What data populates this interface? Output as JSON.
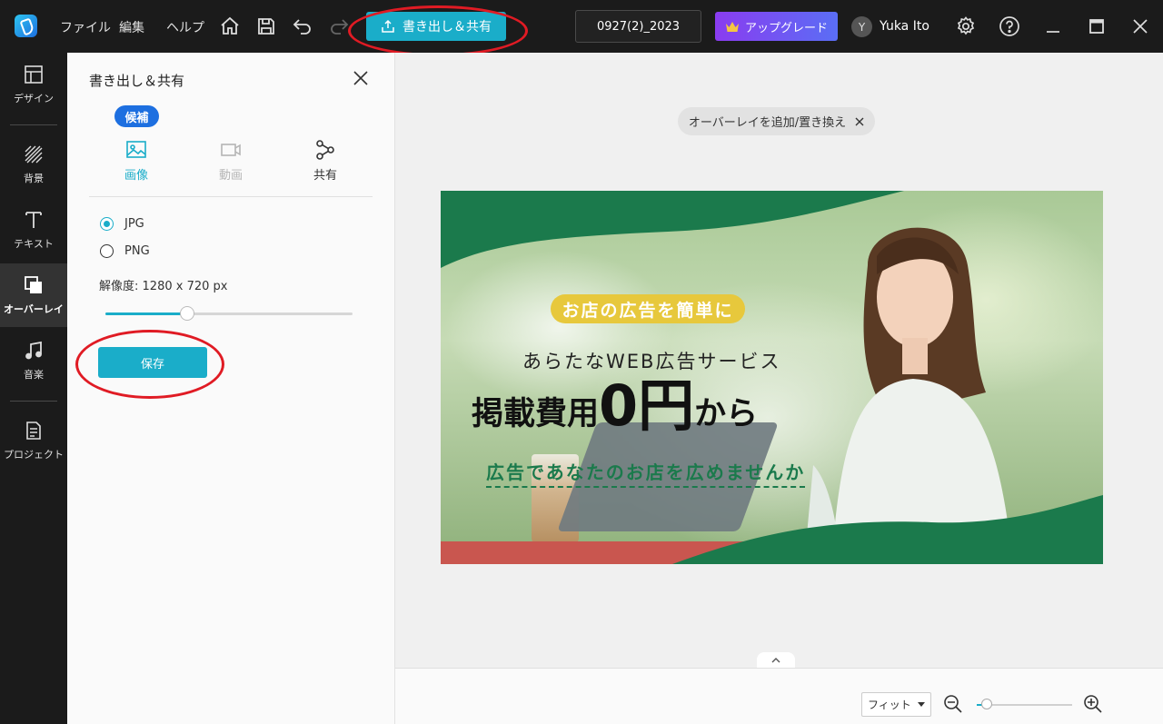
{
  "topbar": {
    "menus": [
      "ファイル",
      "編集",
      "ヘルプ"
    ],
    "export_label": "書き出し＆共有",
    "project_name": "0927(2)_2023",
    "upgrade_label": "アップグレード",
    "avatar_initial": "Y",
    "user_name": "Yuka Ito"
  },
  "rail": {
    "items": [
      {
        "label": "デザイン",
        "icon": "layout-icon"
      },
      {
        "label": "背景",
        "icon": "hatch-icon"
      },
      {
        "label": "テキスト",
        "icon": "text-icon"
      },
      {
        "label": "オーバーレイ",
        "icon": "overlay-icon"
      },
      {
        "label": "音楽",
        "icon": "music-icon"
      },
      {
        "label": "プロジェクト",
        "icon": "document-icon"
      }
    ]
  },
  "panel": {
    "title": "書き出し＆共有",
    "badge": "候補",
    "tabs": [
      {
        "label": "画像",
        "state": "active"
      },
      {
        "label": "動画",
        "state": "disabled"
      },
      {
        "label": "共有",
        "state": "normal"
      }
    ],
    "formats": [
      {
        "label": "JPG",
        "checked": true
      },
      {
        "label": "PNG",
        "checked": false
      }
    ],
    "resolution_label": "解像度:",
    "resolution_value": "1280 x 720 px",
    "resolution_slider_fraction": 0.33,
    "save_label": "保存"
  },
  "canvas": {
    "overlay_chip": "オーバーレイを追加/置き換え",
    "banner": {
      "tagline": "お店の広告を簡単に",
      "headline_1": "あらたなWEB広告サービス",
      "headline_2a": "掲載費用",
      "headline_2b": "0円",
      "headline_2c": "から",
      "headline_3": "広告であなたのお店を広めませんか"
    }
  },
  "bottombar": {
    "fit_label": "フィット",
    "zoom_fraction": 0.1
  },
  "colors": {
    "accent": "#1aadc9",
    "badge_blue": "#1d6fe0",
    "banner_green": "#1b7a4c",
    "annotation_red": "#e01b24"
  }
}
